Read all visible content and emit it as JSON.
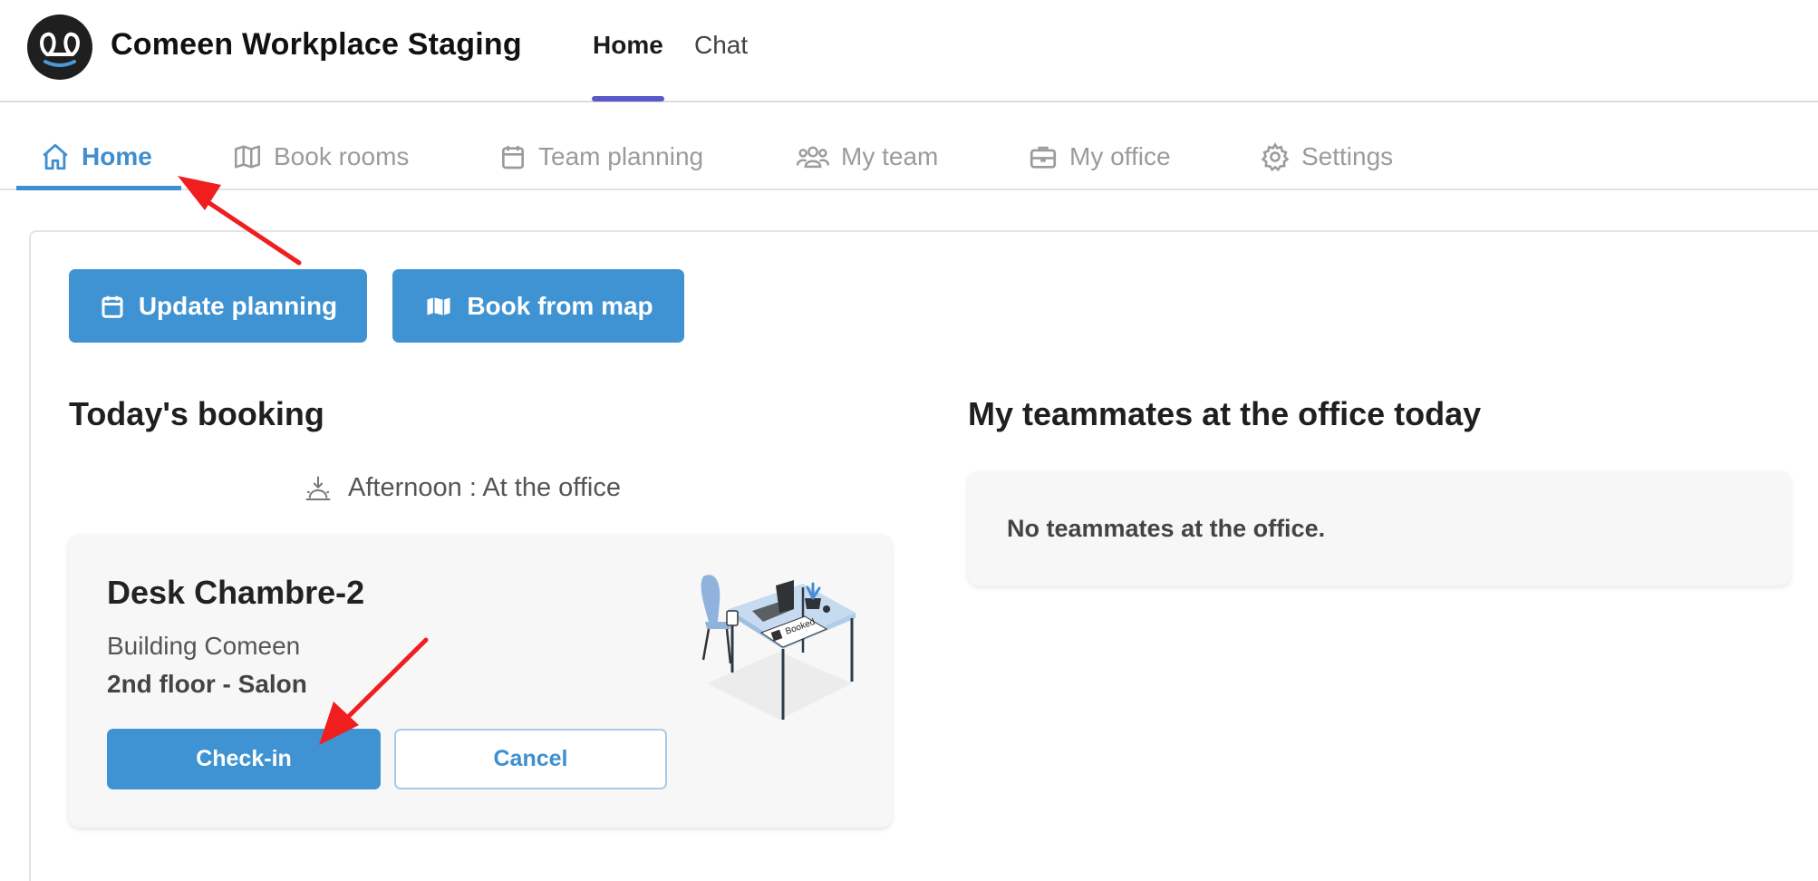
{
  "app": {
    "title": "Comeen Workplace Staging",
    "logo_icon": "pretzel-logo-icon"
  },
  "topnav": {
    "items": [
      {
        "label": "Home",
        "active": true
      },
      {
        "label": "Chat",
        "active": false
      }
    ],
    "accent_color": "#5b57c9"
  },
  "tabs": {
    "items": [
      {
        "label": "Home",
        "icon": "home-icon",
        "active": true
      },
      {
        "label": "Book rooms",
        "icon": "map-icon",
        "active": false
      },
      {
        "label": "Team planning",
        "icon": "calendar-icon",
        "active": false
      },
      {
        "label": "My team",
        "icon": "team-icon",
        "active": false
      },
      {
        "label": "My office",
        "icon": "briefcase-icon",
        "active": false
      },
      {
        "label": "Settings",
        "icon": "gear-icon",
        "active": false
      }
    ],
    "active_color": "#3f8fd0"
  },
  "actions": {
    "update_planning": "Update planning",
    "book_from_map": "Book from map"
  },
  "today": {
    "title": "Today's booking",
    "slot": "Afternoon : At the office",
    "booking": {
      "desk": "Desk Chambre-2",
      "building": "Building Comeen",
      "floor": "2nd floor - Salon",
      "checkin_label": "Check-in",
      "cancel_label": "Cancel",
      "illustration_label": "Booked"
    }
  },
  "teammates": {
    "title": "My teammates at the office today",
    "empty_message": "No teammates at the office."
  },
  "colors": {
    "primary_button": "#3f93d2",
    "annotation_arrow": "#f01e1e"
  }
}
